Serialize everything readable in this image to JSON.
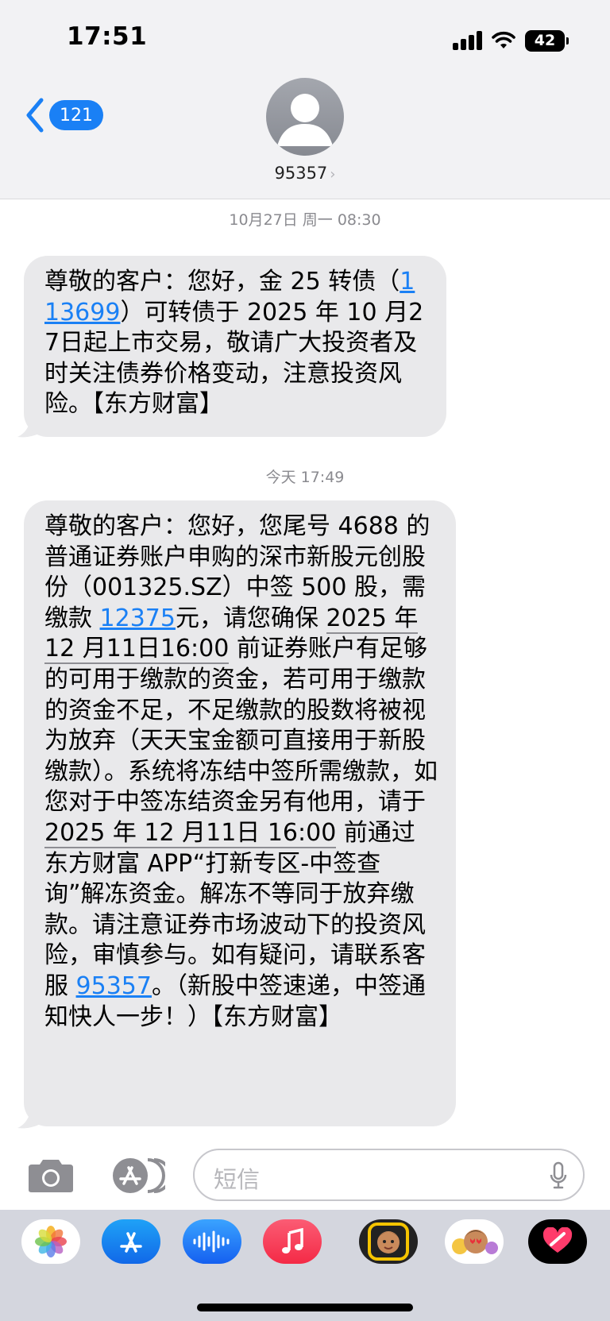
{
  "status_bar": {
    "time": "17:51",
    "battery": "42"
  },
  "nav": {
    "back_count": "121",
    "contact_name": "95357",
    "contact_chevron": "›"
  },
  "messages": [
    {
      "timestamp": "10月27日 周一 08:30",
      "parts": [
        {
          "t": "尊敬的客户：您好，金 25 转债（"
        },
        {
          "t": "113699",
          "link": true
        },
        {
          "t": "）可转债于 2025 年 10 月27日起上市交易，敬请广大投资者及时关注债券价格变动，注意投资风险。【东方财富】"
        }
      ]
    },
    {
      "timestamp": "今天 17:49",
      "parts": [
        {
          "t": "尊敬的客户：您好，您尾号 4688 的普通证券账户申购的深市新股元创股份（001325.SZ）中签 500 股，需缴款 "
        },
        {
          "t": "12375",
          "link": true
        },
        {
          "t": "元，请您确保 "
        },
        {
          "t": "2025 年 12 月11日16:00",
          "dt": true
        },
        {
          "t": " 前证券账户有足够的可用于缴款的资金，若可用于缴款的资金不足，不足缴款的股数将被视为放弃（天天宝金额可直接用于新股缴款）。系统将冻结中签所需缴款，如您对于中签冻结资金另有他用，请于 "
        },
        {
          "t": "2025 年 12 月11日 16:00",
          "dt": true
        },
        {
          "t": " 前通过东方财富 APP“打新专区-中签查询”解冻资金。解冻不等同于放弃缴款。请注意证券市场波动下的投资风险，审慎参与。如有疑问，请联系客服 "
        },
        {
          "t": "95357",
          "link": true
        },
        {
          "t": "。（新股中签速递，中签通知快人一步！）【东方财富】"
        }
      ]
    }
  ],
  "input": {
    "placeholder": "短信"
  },
  "app_strip": [
    "photos-app",
    "app-store-app",
    "audio-app",
    "music-app",
    "memoji-app",
    "memoji-stickers-app",
    "fitness-app"
  ]
}
